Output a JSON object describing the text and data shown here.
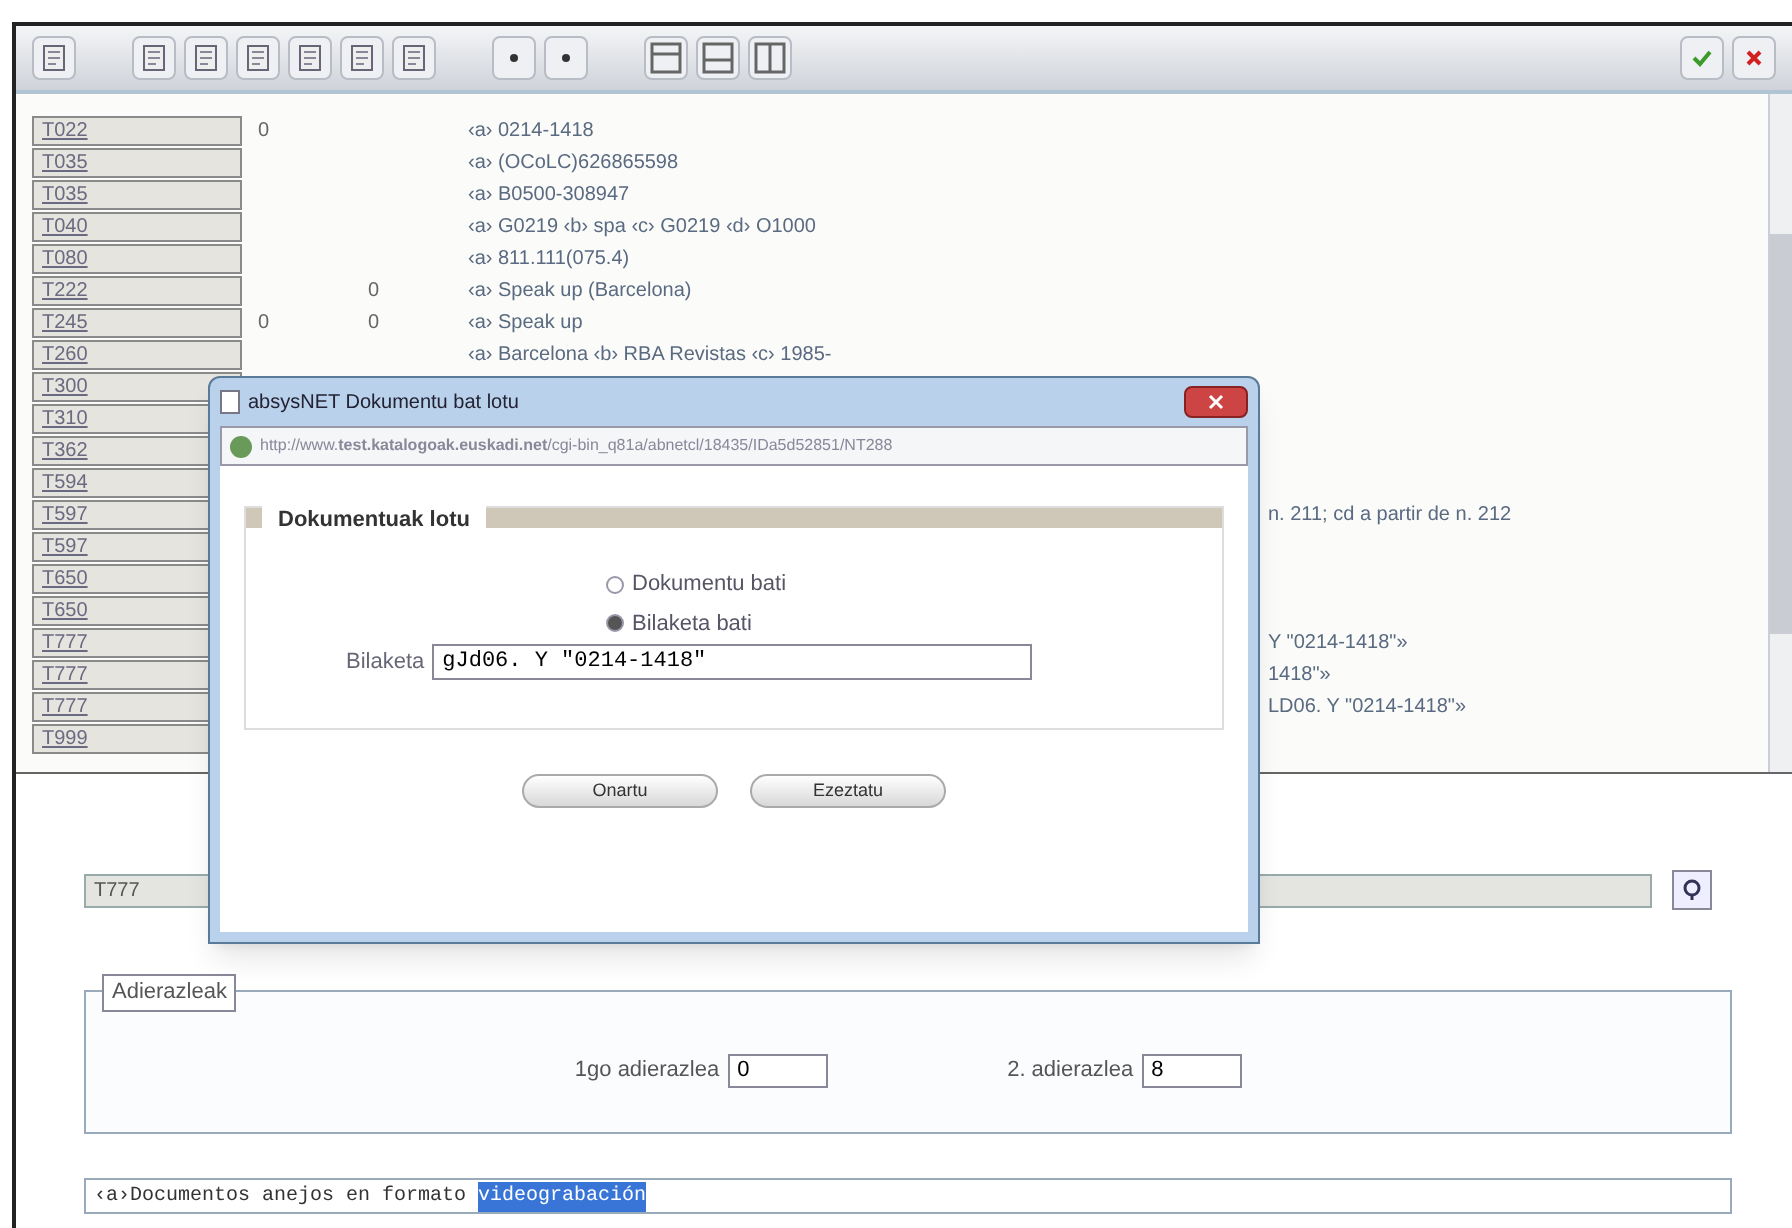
{
  "fields": [
    {
      "tag": "T022",
      "ind1": "0",
      "content": "‹a› 0214-1418"
    },
    {
      "tag": "T035",
      "content": "‹a› (OCoLC)626865598"
    },
    {
      "tag": "T035",
      "content": "‹a› B0500-308947"
    },
    {
      "tag": "T040",
      "content": "‹a› G0219 ‹b› spa ‹c› G0219 ‹d› O1000"
    },
    {
      "tag": "T080",
      "content": "‹a› 811.111(075.4)"
    },
    {
      "tag": "T222",
      "ind2": "0",
      "content": "‹a› Speak up (Barcelona)"
    },
    {
      "tag": "T245",
      "ind1": "0",
      "ind2": "0",
      "content": "‹a› Speak up"
    },
    {
      "tag": "T260",
      "content": "‹a› Barcelona ‹b› RBA Revistas ‹c› 1985-"
    },
    {
      "tag": "T300"
    },
    {
      "tag": "T310"
    },
    {
      "tag": "T362"
    },
    {
      "tag": "T594"
    },
    {
      "tag": "T597",
      "tail": "n. 211; cd a partir de n. 212"
    },
    {
      "tag": "T597"
    },
    {
      "tag": "T650"
    },
    {
      "tag": "T650"
    },
    {
      "tag": "T777",
      "tail": "Y \"0214-1418\"»"
    },
    {
      "tag": "T777",
      "tail": "1418\"»"
    },
    {
      "tag": "T777",
      "tail": "LD06. Y \"0214-1418\"»"
    },
    {
      "tag": "T999"
    }
  ],
  "tag_field": {
    "value": "T777"
  },
  "indicators": {
    "legend": "Adierazleak",
    "items": [
      {
        "label": "1go adierazlea",
        "value": "0"
      },
      {
        "label": "2. adierazlea",
        "value": "8"
      }
    ]
  },
  "content_field": {
    "text": "‹a›Documentos anejos en formato ",
    "selected_text": "videograbación"
  },
  "dialog": {
    "title": "absysNET Dokumentu bat lotu",
    "url": "http://www.**test.katalogoak.euskadi.net**/cgi-bin_q81a/abnetcl/18435/IDa5d52851/NT288",
    "legend": "Dokumentuak lotu",
    "options": [
      {
        "label": "Dokumentu bati",
        "selected": false
      },
      {
        "label": "Bilaketa bati",
        "selected": true
      }
    ],
    "search_label": "Bilaketa",
    "search_value": "gJd06. Y \"0214-1418\"",
    "buttons": [
      "Onartu",
      "Ezeztatu"
    ]
  }
}
